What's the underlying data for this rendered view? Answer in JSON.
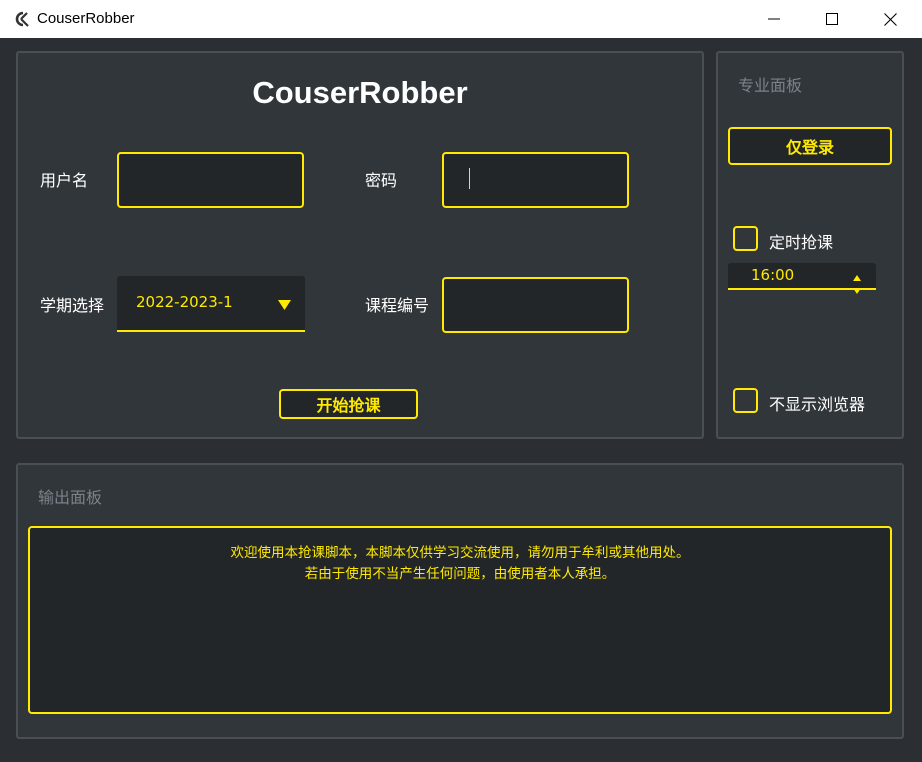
{
  "window": {
    "title": "CouserRobber"
  },
  "main": {
    "heading": "CouserRobber",
    "username_label": "用户名",
    "username_value": "",
    "password_label": "密码",
    "password_value": "",
    "term_label": "学期选择",
    "term_value": "2022-2023-1",
    "course_label": "课程编号",
    "course_value": "",
    "start_button": "开始抢课"
  },
  "pro_panel": {
    "title": "专业面板",
    "login_only_button": "仅登录",
    "timed_checkbox_label": "定时抢课",
    "timed_checked": false,
    "time_value": "16:00",
    "hide_browser_label": "不显示浏览器",
    "hide_browser_checked": false
  },
  "output_panel": {
    "title": "输出面板",
    "lines": [
      "欢迎使用本抢课脚本，本脚本仅供学习交流使用，请勿用于牟利或其他用处。",
      "若由于使用不当产生任何问题，由使用者本人承担。"
    ]
  },
  "colors": {
    "accent": "#ffea00",
    "background": "#2b2e33",
    "panel": "#31363b",
    "input": "#232629"
  },
  "icons": {
    "app": "app-logo-icon",
    "minimize": "minimize-icon",
    "maximize": "maximize-icon",
    "close": "close-icon",
    "dropdown": "triangle-down-icon",
    "spin_up": "spin-up-icon",
    "spin_down": "spin-down-icon"
  }
}
